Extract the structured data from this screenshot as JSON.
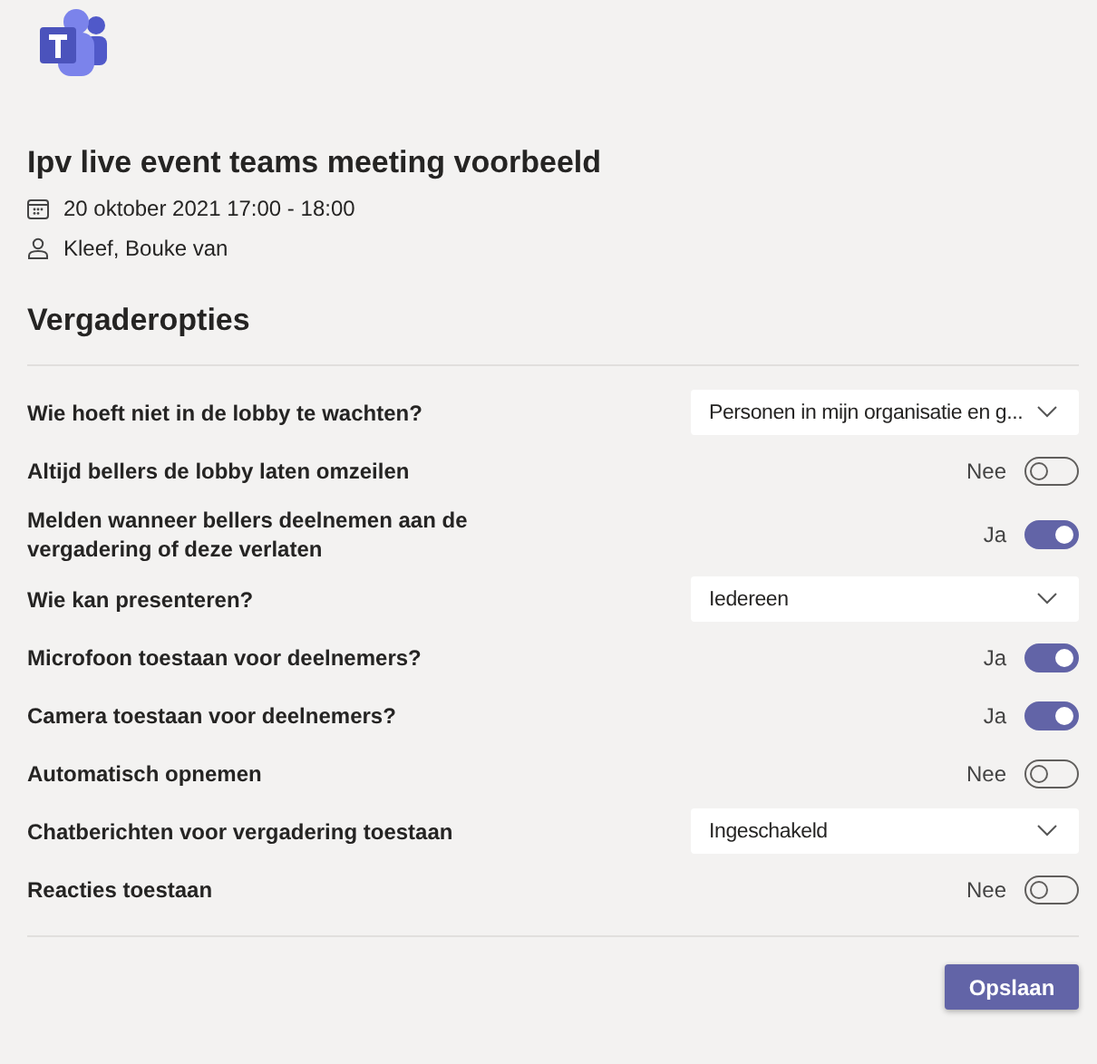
{
  "meeting": {
    "title": "Ipv live event teams meeting voorbeeld",
    "datetime": "20 oktober 2021 17:00 - 18:00",
    "organizer": "Kleef, Bouke van"
  },
  "section_title": "Vergaderopties",
  "options": [
    {
      "kind": "dropdown",
      "label": "Wie hoeft niet in de lobby te wachten?",
      "value": "Personen in mijn organisatie en g..."
    },
    {
      "kind": "toggle",
      "label": "Altijd bellers de lobby laten omzeilen",
      "on": false,
      "state_text": "Nee"
    },
    {
      "kind": "toggle",
      "label": "Melden wanneer bellers deelnemen aan de vergadering of deze verlaten",
      "on": true,
      "state_text": "Ja"
    },
    {
      "kind": "dropdown",
      "label": "Wie kan presenteren?",
      "value": "Iedereen"
    },
    {
      "kind": "toggle",
      "label": "Microfoon toestaan voor deelnemers?",
      "on": true,
      "state_text": "Ja"
    },
    {
      "kind": "toggle",
      "label": "Camera toestaan voor deelnemers?",
      "on": true,
      "state_text": "Ja"
    },
    {
      "kind": "toggle",
      "label": "Automatisch opnemen",
      "on": false,
      "state_text": "Nee"
    },
    {
      "kind": "dropdown",
      "label": "Chatberichten voor vergadering toestaan",
      "value": "Ingeschakeld"
    },
    {
      "kind": "toggle",
      "label": "Reacties toestaan",
      "on": false,
      "state_text": "Nee"
    }
  ],
  "save_button": "Opslaan"
}
